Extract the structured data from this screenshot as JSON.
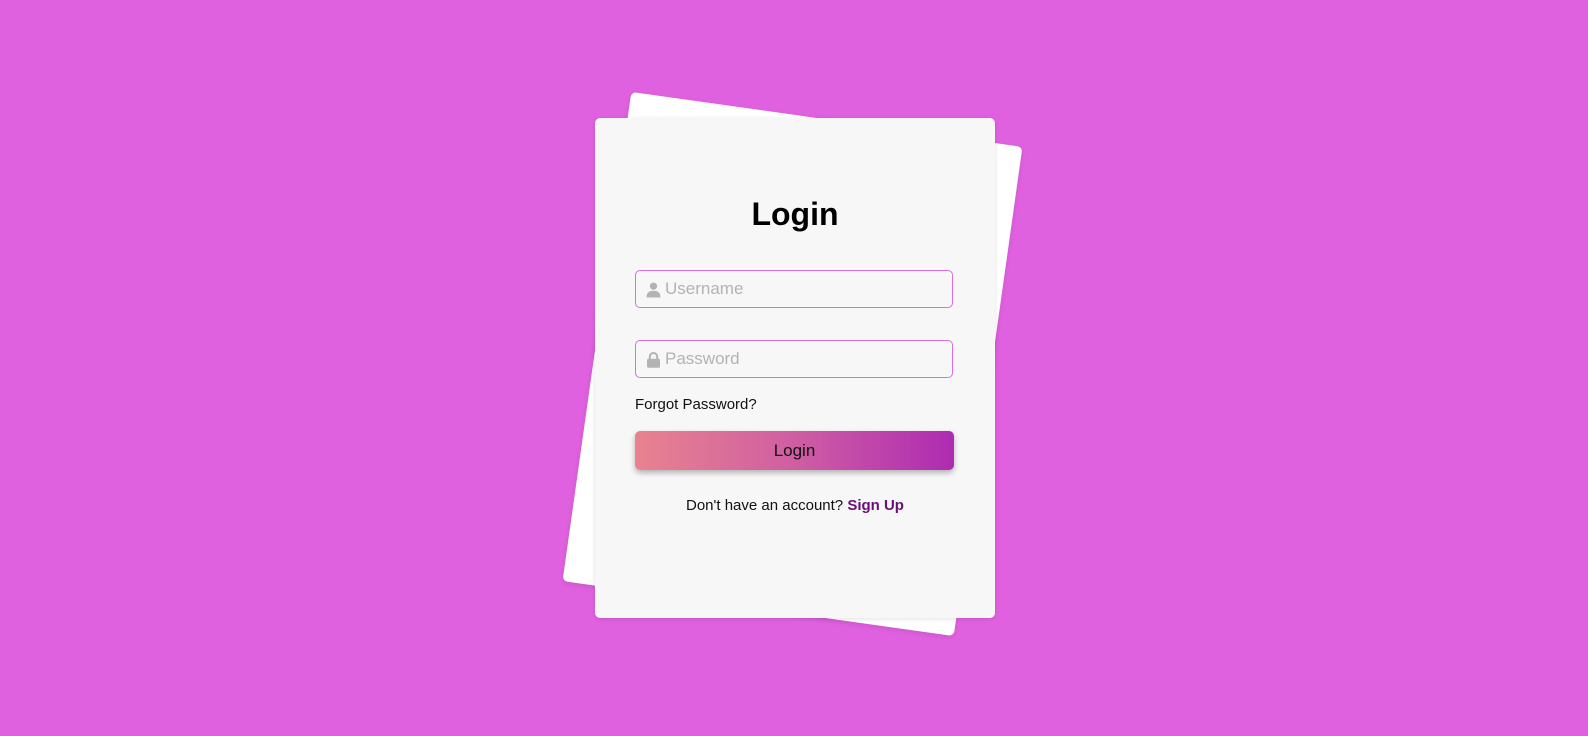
{
  "colors": {
    "background": "#e061e0",
    "card": "#f7f7f7",
    "input_border": "#d96ee0",
    "button_gradient_start": "#e8838f",
    "button_gradient_end": "#ae2bb3",
    "signup_link": "#6a0f74"
  },
  "login_form": {
    "title": "Login",
    "username": {
      "placeholder": "Username",
      "value": "",
      "icon": "user-icon"
    },
    "password": {
      "placeholder": "Password",
      "value": "",
      "icon": "lock-icon"
    },
    "forgot_password_label": "Forgot Password?",
    "submit_label": "Login",
    "signup_prompt": "Don't have an account?",
    "signup_link_label": "Sign Up"
  }
}
